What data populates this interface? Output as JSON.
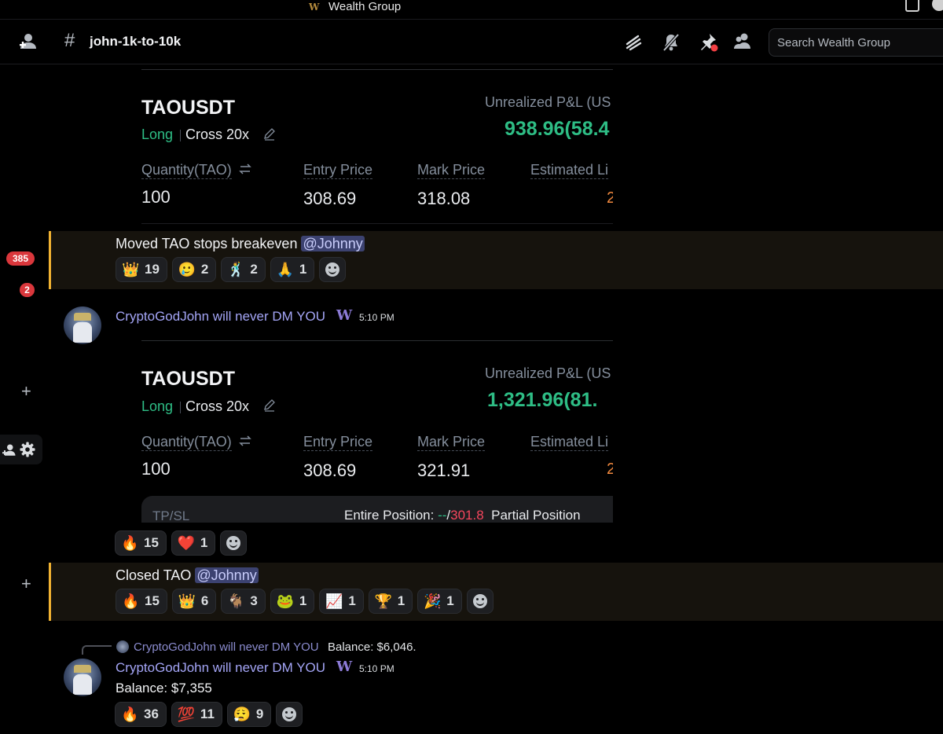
{
  "window": {
    "title": "Wealth Group",
    "logo_letter": "W"
  },
  "header": {
    "channel": "john-1k-to-10k",
    "search_placeholder": "Search Wealth Group"
  },
  "gutter": {
    "badge_1": "385",
    "badge_2": "2"
  },
  "card1": {
    "pair": "TAOUSDT",
    "side": "Long",
    "margin": "Cross 20x",
    "pnl_label": "Unrealized P&L (US",
    "pnl_value": "938.96(58.4",
    "qty_label": "Quantity(TAO)",
    "qty": "100",
    "entry_label": "Entry Price",
    "entry": "308.69",
    "mark_label": "Mark Price",
    "mark": "318.08",
    "liq_label": "Estimated Li",
    "liq": "2"
  },
  "mention1": {
    "text": "Moved TAO stops breakeven",
    "mention": "@Johnny",
    "reactions": [
      {
        "emoji": "👑",
        "count": "19"
      },
      {
        "emoji": "🥲",
        "count": "2"
      },
      {
        "emoji": "🕺",
        "count": "2"
      },
      {
        "emoji": "🙏",
        "count": "1"
      }
    ]
  },
  "message2": {
    "username": "CryptoGodJohn will never DM YOU",
    "badge": "W",
    "time": "5:10 PM",
    "card": {
      "pair": "TAOUSDT",
      "side": "Long",
      "margin": "Cross 20x",
      "pnl_label": "Unrealized P&L (US",
      "pnl_value": "1,321.96(81.",
      "qty_label": "Quantity(TAO)",
      "qty": "100",
      "entry_label": "Entry Price",
      "entry": "308.69",
      "mark_label": "Mark Price",
      "mark": "321.91",
      "liq_label": "Estimated Li",
      "liq": "2",
      "tpsl_label": "TP/SL",
      "entire_label": "Entire Position:",
      "tp": "--",
      "sl": "301.8",
      "partial_label": "Partial Position"
    },
    "reactions": [
      {
        "emoji": "🔥",
        "count": "15"
      },
      {
        "emoji": "❤️",
        "count": "1"
      }
    ]
  },
  "mention2": {
    "text": "Closed TAO",
    "mention": "@Johnny",
    "reactions": [
      {
        "emoji": "🔥",
        "count": "15"
      },
      {
        "emoji": "👑",
        "count": "6"
      },
      {
        "emoji": "🐐",
        "count": "3"
      },
      {
        "emoji": "🐸",
        "count": "1"
      },
      {
        "emoji": "📈",
        "count": "1"
      },
      {
        "emoji": "🏆",
        "count": "1"
      },
      {
        "emoji": "🎉",
        "count": "1"
      }
    ]
  },
  "message3": {
    "reply_user": "CryptoGodJohn will never DM YOU",
    "reply_text": "Balance: $6,046.",
    "username": "CryptoGodJohn will never DM YOU",
    "badge": "W",
    "time": "5:10 PM",
    "text": "Balance: $7,355",
    "reactions": [
      {
        "emoji": "🔥",
        "count": "36"
      },
      {
        "emoji": "💯",
        "count": "11"
      },
      {
        "emoji": "😮‍💨",
        "count": "9"
      }
    ]
  },
  "icons": [
    "add-friend-icon",
    "hash-icon",
    "threads-icon",
    "mute-icon",
    "pin-icon",
    "members-icon",
    "inbox-icon",
    "help-icon",
    "pencil-icon",
    "swap-icon",
    "add-reaction-icon",
    "settings-icon"
  ]
}
